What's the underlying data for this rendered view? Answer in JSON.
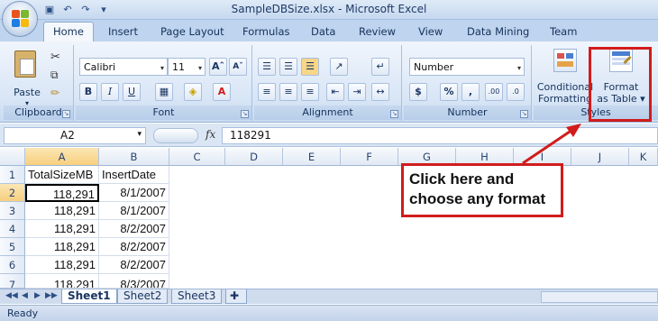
{
  "window": {
    "title": "SampleDBSize.xlsx - Microsoft Excel"
  },
  "quick_access": [
    "save-icon",
    "undo-icon",
    "redo-icon",
    "customize-icon"
  ],
  "tabs": [
    "Home",
    "Insert",
    "Page Layout",
    "Formulas",
    "Data",
    "Review",
    "View",
    "Data Mining",
    "Team"
  ],
  "active_tab": "Home",
  "ribbon": {
    "clipboard": {
      "label": "Clipboard",
      "paste": "Paste"
    },
    "font": {
      "label": "Font",
      "name": "Calibri",
      "size": "11",
      "bold": "B",
      "italic": "I",
      "underline": "U"
    },
    "alignment": {
      "label": "Alignment"
    },
    "number": {
      "label": "Number",
      "format": "Number",
      "currency": "$",
      "percent": "%",
      "comma": ",",
      "inc_decimal": ".00",
      "dec_decimal": ".0"
    },
    "styles": {
      "label": "Styles",
      "conditional": "Conditional",
      "conditional2": "Formatting",
      "format": "Format",
      "as_table": "as Table"
    }
  },
  "formula_bar": {
    "name_box": "A2",
    "fx": "fx",
    "value": "118291"
  },
  "columns": [
    "A",
    "B",
    "C",
    "D",
    "E",
    "F",
    "G",
    "H",
    "I",
    "J",
    "K"
  ],
  "rows": [
    {
      "num": "1",
      "a": "TotalSizeMB",
      "b": "InsertDate"
    },
    {
      "num": "2",
      "a": "118,291",
      "b": "8/1/2007"
    },
    {
      "num": "3",
      "a": "118,291",
      "b": "8/1/2007"
    },
    {
      "num": "4",
      "a": "118,291",
      "b": "8/2/2007"
    },
    {
      "num": "5",
      "a": "118,291",
      "b": "8/2/2007"
    },
    {
      "num": "6",
      "a": "118,291",
      "b": "8/2/2007"
    },
    {
      "num": "7",
      "a": "118,291",
      "b": "8/3/2007"
    }
  ],
  "sheets": [
    "Sheet1",
    "Sheet2",
    "Sheet3"
  ],
  "active_sheet": "Sheet1",
  "status": "Ready",
  "callout": {
    "line1": "Click here and",
    "line2": "choose any format"
  },
  "colors": {
    "accent": "#d11c1c",
    "ribbon": "#d9e6f6"
  }
}
